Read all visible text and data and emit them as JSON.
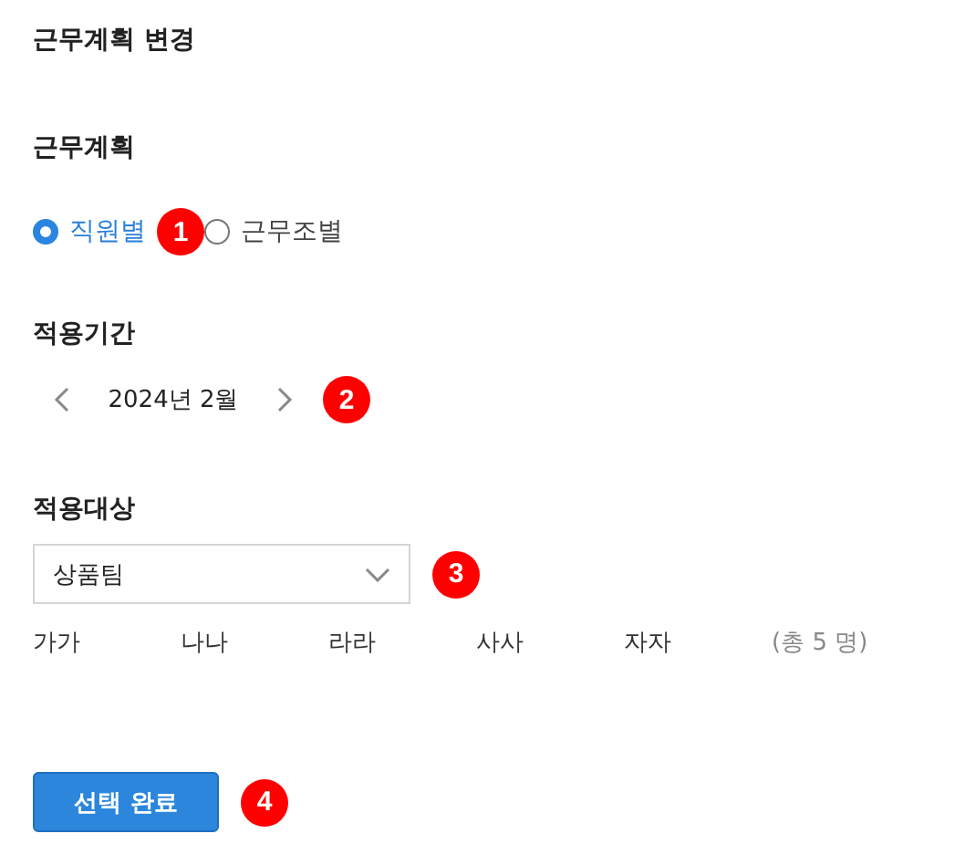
{
  "title": "근무계획 변경",
  "plan": {
    "label": "근무계획",
    "options": [
      {
        "label": "직원별",
        "selected": true
      },
      {
        "label": "근무조별",
        "selected": false
      }
    ],
    "badge": "1"
  },
  "period": {
    "label": "적용기간",
    "value": "2024년 2월",
    "badge": "2"
  },
  "target": {
    "label": "적용대상",
    "select": "상품팀",
    "badge": "3",
    "members": [
      "가가",
      "나나",
      "라라",
      "사사",
      "자자"
    ],
    "total": "(총 5 명)"
  },
  "submit": {
    "label": "선택 완료",
    "badge": "4"
  }
}
